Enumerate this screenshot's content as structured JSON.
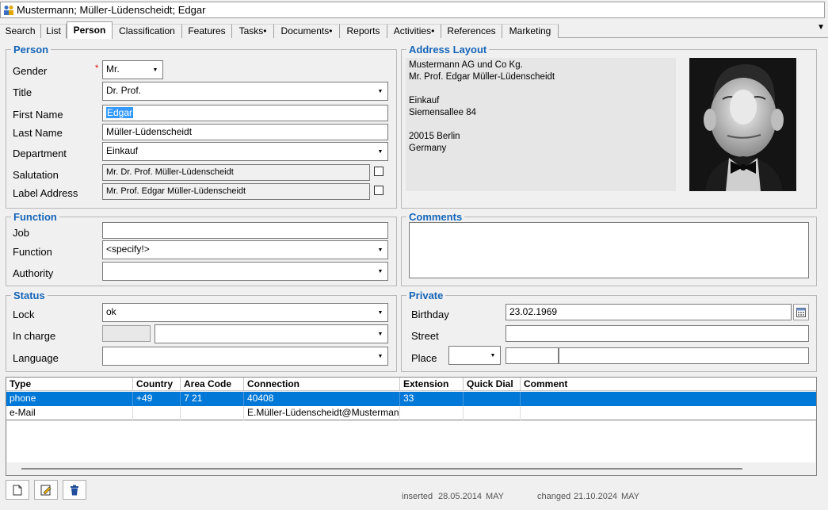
{
  "window": {
    "title": "Mustermann; Müller-Lüdenscheidt; Edgar"
  },
  "tabs": [
    "Search",
    "List",
    "Person",
    "Classification",
    "Features",
    "Tasks•",
    "Documents•",
    "Reports",
    "Activities•",
    "References",
    "Marketing"
  ],
  "person": {
    "section": "Person",
    "gender_label": "Gender",
    "gender_value": "Mr.",
    "required_mark": "*",
    "title_label": "Title",
    "title_value": "Dr. Prof.",
    "firstname_label": "First Name",
    "firstname_value": "Edgar",
    "lastname_label": "Last Name",
    "lastname_value": "Müller-Lüdenscheidt",
    "department_label": "Department",
    "department_value": "Einkauf",
    "salutation_label": "Salutation",
    "salutation_value": "Mr. Dr. Prof. Müller-Lüdenscheidt",
    "labeladdr_label": "Label Address",
    "labeladdr_value": "Mr. Prof. Edgar Müller-Lüdenscheidt"
  },
  "address": {
    "section": "Address Layout",
    "lines": [
      "Mustermann AG und Co Kg.",
      "Mr. Prof. Edgar Müller-Lüdenscheidt",
      "",
      "Einkauf",
      "Siemensallee 84",
      "",
      "20015 Berlin",
      "Germany"
    ]
  },
  "function": {
    "section": "Function",
    "job_label": "Job",
    "job_value": "",
    "function_label": "Function",
    "function_value": "<specify!>",
    "authority_label": "Authority",
    "authority_value": ""
  },
  "comments": {
    "section": "Comments",
    "value": ""
  },
  "status": {
    "section": "Status",
    "lock_label": "Lock",
    "lock_value": "ok",
    "incharge_label": "In charge",
    "incharge_code": "",
    "incharge_value": "",
    "language_label": "Language",
    "language_value": ""
  },
  "private": {
    "section": "Private",
    "birthday_label": "Birthday",
    "birthday_value": "23.02.1969",
    "street_label": "Street",
    "street_value": "",
    "place_label": "Place",
    "place_country": "",
    "place_zip": "",
    "place_city": ""
  },
  "contacts": {
    "columns": [
      "Type",
      "Country",
      "Area Code",
      "Connection",
      "Extension",
      "Quick Dial",
      "Comment"
    ],
    "rows": [
      [
        "phone",
        "+49",
        "7 21",
        "40408",
        "33",
        "",
        ""
      ],
      [
        "e-Mail",
        "",
        "",
        "E.Müller-Lüdenscheidt@Mustermann",
        "",
        "",
        ""
      ]
    ]
  },
  "footer": {
    "inserted_label": "inserted",
    "inserted_date": "28.05.2014",
    "inserted_user": "MAY",
    "changed_label": "changed",
    "changed_date": "21.10.2024",
    "changed_user": "MAY"
  },
  "icons": {
    "new": "new-document-icon",
    "edit": "edit-icon",
    "delete": "trash-icon",
    "calendar": "calendar-icon",
    "menu": "chevron-down-icon"
  }
}
